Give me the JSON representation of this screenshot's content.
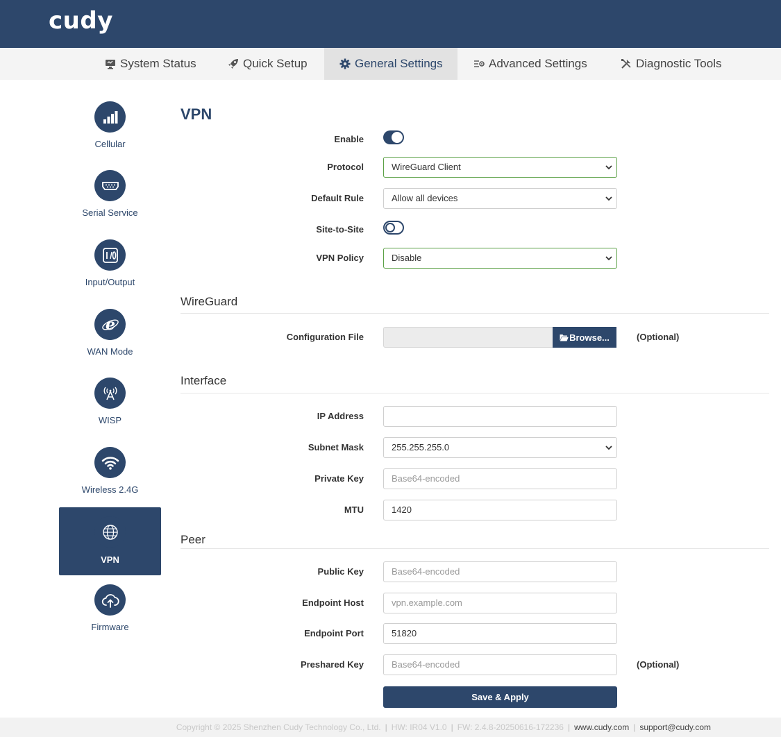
{
  "brand": {
    "logo": "cudy"
  },
  "nav": [
    {
      "label": "System Status",
      "icon": "monitor-icon"
    },
    {
      "label": "Quick Setup",
      "icon": "rocket-icon"
    },
    {
      "label": "General Settings",
      "icon": "gear-icon",
      "active": true
    },
    {
      "label": "Advanced Settings",
      "icon": "sliders-gear-icon"
    },
    {
      "label": "Diagnostic Tools",
      "icon": "tools-icon"
    }
  ],
  "sidebar": [
    {
      "label": "Cellular",
      "icon": "signal-bars-icon"
    },
    {
      "label": "Serial Service",
      "icon": "serial-port-icon"
    },
    {
      "label": "Input/Output",
      "icon": "io-icon"
    },
    {
      "label": "WAN Mode",
      "icon": "internet-e-icon"
    },
    {
      "label": "WISP",
      "icon": "antenna-icon"
    },
    {
      "label": "Wireless 2.4G",
      "icon": "wifi-icon"
    },
    {
      "label": "VPN",
      "icon": "globe-icon",
      "active": true
    },
    {
      "label": "Firmware",
      "icon": "cloud-upload-icon"
    }
  ],
  "page": {
    "title": "VPN"
  },
  "vpn": {
    "enable_label": "Enable",
    "enable_on": true,
    "protocol_label": "Protocol",
    "protocol_value": "WireGuard Client",
    "default_rule_label": "Default Rule",
    "default_rule_value": "Allow all devices",
    "site_to_site_label": "Site-to-Site",
    "site_to_site_on": false,
    "vpn_policy_label": "VPN Policy",
    "vpn_policy_value": "Disable"
  },
  "wireguard": {
    "title": "WireGuard",
    "config_file_label": "Configuration File",
    "browse_label": "Browse...",
    "optional": "(Optional)"
  },
  "interface": {
    "title": "Interface",
    "ip_label": "IP Address",
    "ip_value": "",
    "subnet_label": "Subnet Mask",
    "subnet_value": "255.255.255.0",
    "private_key_label": "Private Key",
    "private_key_placeholder": "Base64-encoded",
    "mtu_label": "MTU",
    "mtu_value": "1420"
  },
  "peer": {
    "title": "Peer",
    "public_key_label": "Public Key",
    "public_key_placeholder": "Base64-encoded",
    "endpoint_host_label": "Endpoint Host",
    "endpoint_host_placeholder": "vpn.example.com",
    "endpoint_port_label": "Endpoint Port",
    "endpoint_port_value": "51820",
    "preshared_key_label": "Preshared Key",
    "preshared_key_placeholder": "Base64-encoded",
    "optional": "(Optional)"
  },
  "actions": {
    "apply_label": "Save & Apply"
  },
  "footer": {
    "copyright": "Copyright © 2025 Shenzhen Cudy Technology Co., Ltd.",
    "hw": "HW: IR04 V1.0",
    "fw": "FW: 2.4.8-20250616-172236",
    "website": "www.cudy.com",
    "email": "support@cudy.com"
  },
  "colors": {
    "primary": "#2d476b",
    "valid_border": "#5aa045"
  }
}
